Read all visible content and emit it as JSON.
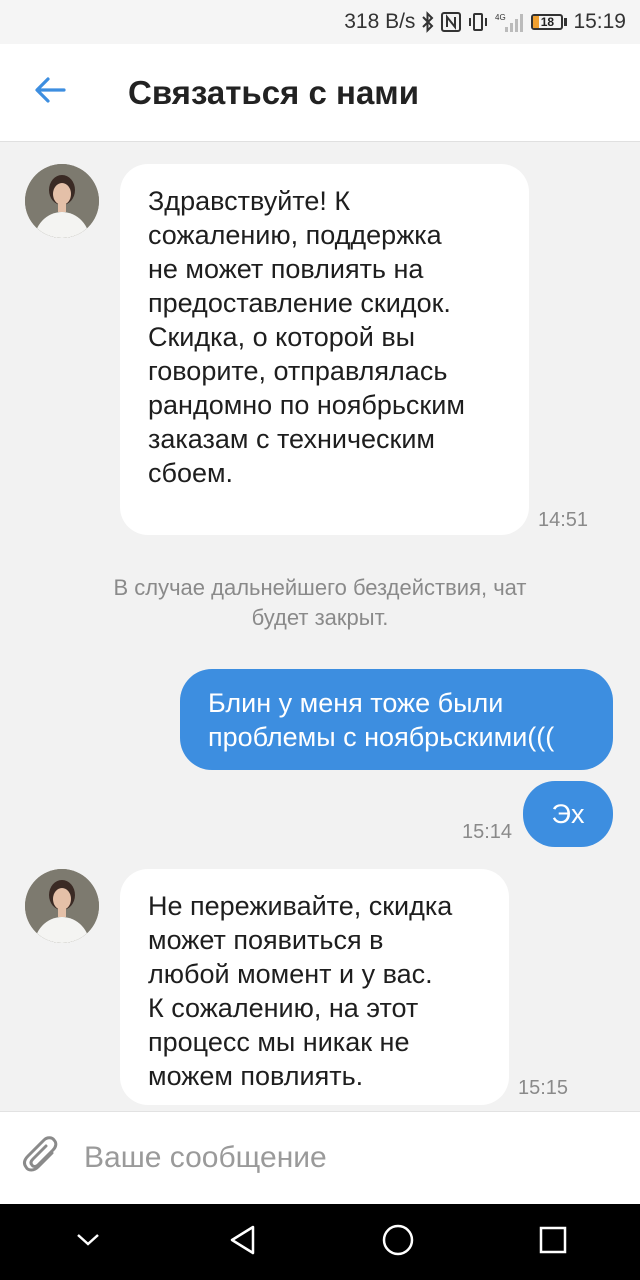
{
  "status_bar": {
    "network_speed": "318 B/s",
    "battery_level": "18",
    "time": "15:19",
    "icons": [
      "bluetooth-icon",
      "nfc-icon",
      "vibrate-icon",
      "signal-icon",
      "battery-icon"
    ]
  },
  "header": {
    "title": "Связаться с нами",
    "back_icon": "arrow-left-icon"
  },
  "messages": [
    {
      "direction": "incoming",
      "text": "Здравствуйте! К\nсожалению, поддержка\nне может повлиять на\nпредоставление скидок.\nСкидка, о которой вы\nговорите, отправлялась\nрандомно по ноябрьским\nзаказам с техническим\nсбоем.",
      "time": "14:51"
    },
    {
      "direction": "system",
      "text": "В случае дальнейшего бездействия, чат\nбудет закрыт."
    },
    {
      "direction": "outgoing",
      "text": "Блин у меня тоже были\nпроблемы с ноябрьскими((("
    },
    {
      "direction": "outgoing",
      "text": "Эх",
      "time": "15:14"
    },
    {
      "direction": "incoming",
      "text": "Не переживайте, скидка\nможет появиться в\nлюбой момент и у вас.\nК сожалению,  на этот\nпроцесс мы никак не\nможем повлиять.",
      "time": "15:15"
    }
  ],
  "composer": {
    "placeholder": "Ваше сообщение",
    "attach_icon": "paperclip-icon"
  },
  "navigation": {
    "icons": [
      "chevron-down-icon",
      "back-triangle-icon",
      "home-circle-icon",
      "recents-square-icon"
    ]
  },
  "colors": {
    "accent": "#3d8ee0",
    "background": "#f2f2f2",
    "incoming_bubble": "#ffffff"
  }
}
